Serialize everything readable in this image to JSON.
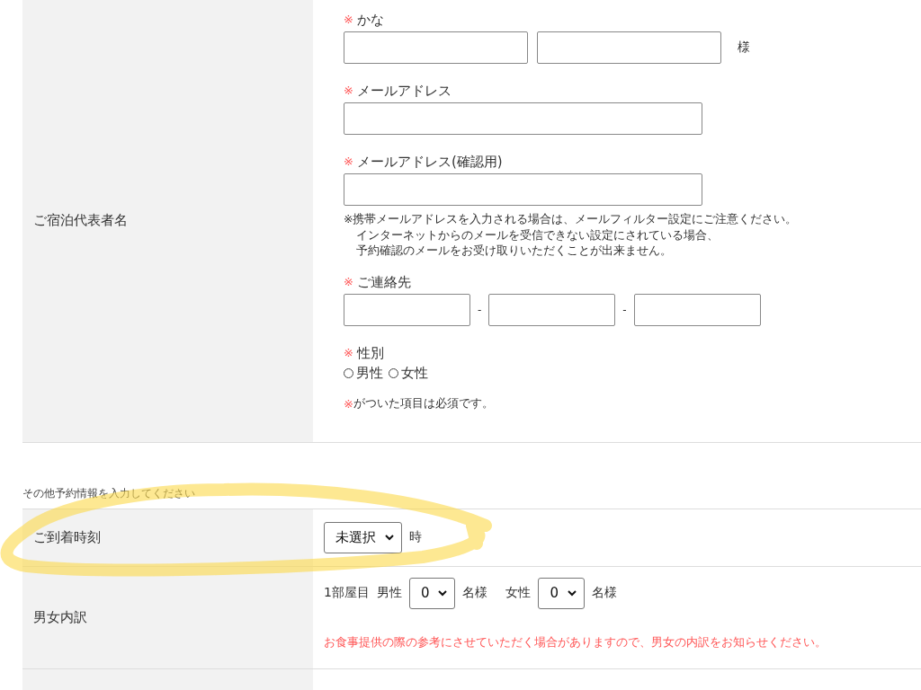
{
  "guest_section": {
    "label": "ご宿泊代表者名",
    "kana": {
      "mark": "※",
      "label": "かな",
      "suffix": "様"
    },
    "email": {
      "mark": "※",
      "label": "メールアドレス"
    },
    "email_confirm": {
      "mark": "※",
      "label": "メールアドレス(確認用)"
    },
    "email_notice": [
      "※携帯メールアドレスを入力される場合は、メールフィルター設定にご注意ください。",
      "インターネットからのメールを受信できない設定にされている場合、",
      "予約確認のメールをお受け取りいただくことが出来ません。"
    ],
    "phone": {
      "mark": "※",
      "label": "ご連絡先",
      "separators": [
        "-",
        "-"
      ]
    },
    "gender": {
      "mark": "※",
      "label": "性別",
      "options": [
        {
          "label": "男性",
          "selected": false
        },
        {
          "label": "女性",
          "selected": false
        }
      ]
    },
    "required_note": {
      "mark": "※",
      "text": "がついた項目は必須です。"
    }
  },
  "other_heading": "その他予約情報を入力してください",
  "arrival": {
    "label": "ご到着時刻",
    "select": "未選択",
    "suffix": "時"
  },
  "breakdown": {
    "label": "男女内訳",
    "room": "1部屋目",
    "male_label": "男性",
    "male_select": "0",
    "male_suffix": "名様",
    "female_label": "女性",
    "female_select": "0",
    "female_suffix": "名様",
    "note": "お食事提供の際の参考にさせていただく場合がありますので、男女の内訳をお知らせください。"
  }
}
